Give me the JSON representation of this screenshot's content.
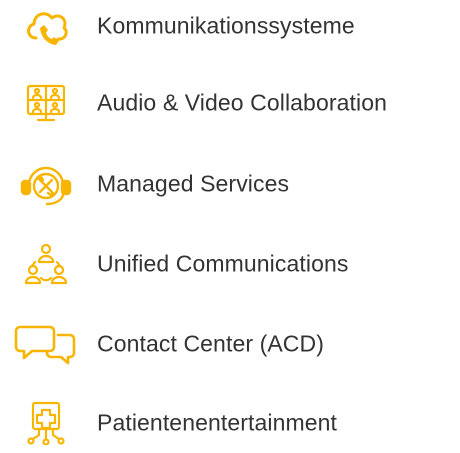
{
  "accent_color": "#F7B500",
  "text_color": "#333333",
  "menu": {
    "items": [
      {
        "label": "Kommunikationssysteme",
        "icon": "phone-cloud-icon"
      },
      {
        "label": "Audio & Video Collaboration",
        "icon": "video-conference-icon"
      },
      {
        "label": "Managed Services",
        "icon": "headset-tools-icon"
      },
      {
        "label": "Unified Communications",
        "icon": "users-network-icon"
      },
      {
        "label": "Contact Center (ACD)",
        "icon": "chat-bubbles-icon"
      },
      {
        "label": "Patientenentertainment",
        "icon": "medical-cross-network-icon"
      }
    ]
  }
}
